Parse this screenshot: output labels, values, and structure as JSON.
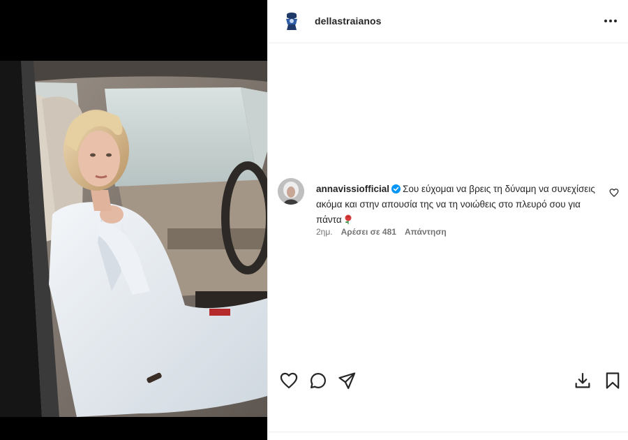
{
  "post": {
    "owner": {
      "username": "dellastraianos",
      "avatar_icon": "profile-avatar",
      "more_icon": "more-options-icon"
    },
    "photo": {
      "alt_subject": "woman-in-white-suit-sitting-in-car"
    },
    "comments": [
      {
        "username": "annavissiofficial",
        "verified": true,
        "text": "Σου εύχομαι να βρεις τη δύναμη να συνεχίσεις ακόμα και στην απουσία της να τη νοιώθεις στο πλευρό σου για πάντα",
        "emoji_icon": "rose-icon",
        "time": "2ημ.",
        "likes": "Αρέσει σε 481",
        "reply": "Απάντηση"
      }
    ],
    "actions": {
      "like_icon": "heart-icon",
      "comment_icon": "comment-icon",
      "share_icon": "send-icon",
      "download_icon": "download-icon",
      "save_icon": "bookmark-icon"
    }
  },
  "colors": {
    "text": "#262626",
    "secondary_text": "#737373",
    "verified": "#0095f6",
    "divider": "#efefef",
    "media_background": "#000000"
  }
}
